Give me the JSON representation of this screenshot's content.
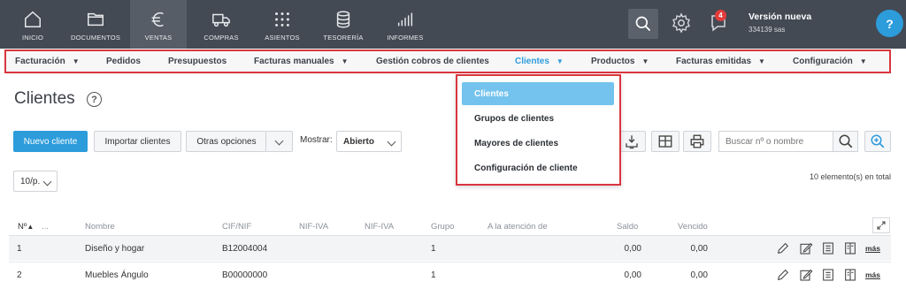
{
  "topnav": {
    "items": [
      {
        "label": "INICIO",
        "icon": "home-icon"
      },
      {
        "label": "DOCUMENTOS",
        "icon": "folder-icon"
      },
      {
        "label": "VENTAS",
        "icon": "euro-icon",
        "active": true
      },
      {
        "label": "COMPRAS",
        "icon": "truck-icon"
      },
      {
        "label": "ASIENTOS",
        "icon": "grid-dots-icon"
      },
      {
        "label": "TESORERÍA",
        "icon": "coins-stack-icon"
      },
      {
        "label": "INFORMES",
        "icon": "bar-chart-icon"
      }
    ],
    "notifications": "4",
    "version": "Versión nueva",
    "company": "334139 sas",
    "help": "?"
  },
  "subnav": {
    "items": [
      {
        "label": "Facturación",
        "caret": true
      },
      {
        "label": "Pedidos",
        "caret": false
      },
      {
        "label": "Presupuestos",
        "caret": false
      },
      {
        "label": "Facturas manuales",
        "caret": true
      },
      {
        "label": "Gestión cobros de clientes",
        "caret": false
      },
      {
        "label": "Clientes",
        "caret": true,
        "active": true
      },
      {
        "label": "Productos",
        "caret": true
      },
      {
        "label": "Facturas emitidas",
        "caret": true
      },
      {
        "label": "Configuración",
        "caret": true
      }
    ]
  },
  "dropdown": {
    "items": [
      "Clientes",
      "Grupos de clientes",
      "Mayores de clientes",
      "Configuración de cliente"
    ]
  },
  "page": {
    "title": "Clientes",
    "help": "?"
  },
  "toolbar": {
    "new_client": "Nuevo cliente",
    "import_clients": "Importar clientes",
    "other_options": "Otras opciones",
    "show_label": "Mostrar:",
    "show_value": "Abierto",
    "per_page": "10/p.",
    "search_placeholder": "Buscar nº o nombre",
    "count_text": "10 elemento(s) en total"
  },
  "table": {
    "headers": {
      "no": "Nº",
      "sort_arrow": "▲",
      "dots": "...",
      "nombre": "Nombre",
      "cif": "CIF/NIF",
      "nifiva1": "NIF-IVA",
      "nifiva2": "NIF-IVA",
      "grupo": "Grupo",
      "atencion": "A la atención de",
      "saldo": "Saldo",
      "vencido": "Vencido"
    },
    "rows": [
      {
        "no": "1",
        "nombre": "Diseño y hogar",
        "cif": "B12004004",
        "grupo": "1",
        "saldo": "0,00",
        "vencido": "0,00",
        "more": "más"
      },
      {
        "no": "2",
        "nombre": "Muebles Ángulo",
        "cif": "B00000000",
        "grupo": "1",
        "saldo": "0,00",
        "vencido": "0,00",
        "more": "más"
      }
    ]
  },
  "colors": {
    "topbar": "#434a54",
    "accent": "#2d9cdb",
    "highlight_border": "#d9363e",
    "dropdown_active": "#74c3ee"
  }
}
